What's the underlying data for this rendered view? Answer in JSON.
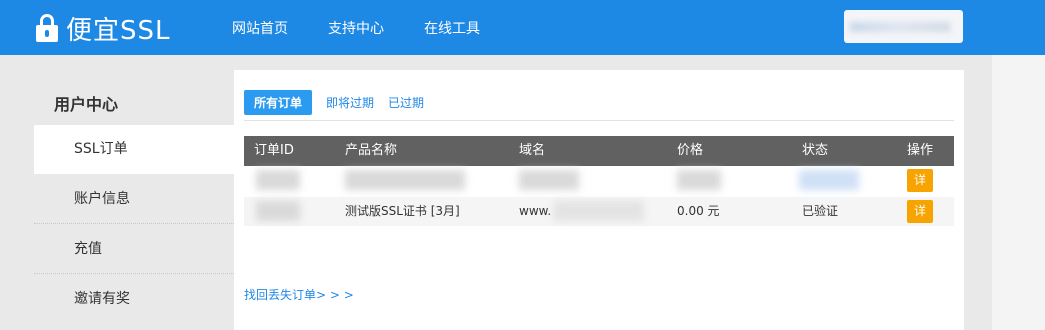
{
  "header": {
    "logo_text": "便宜SSL",
    "nav": [
      "网站首页",
      "支持中心",
      "在线工具"
    ]
  },
  "sidebar": {
    "title": "用户中心",
    "items": [
      "SSL订单",
      "账户信息",
      "充值",
      "邀请有奖"
    ]
  },
  "tabs": [
    "所有订单",
    "即将过期",
    "已过期"
  ],
  "table": {
    "columns": [
      "订单ID",
      "产品名称",
      "域名",
      "价格",
      "状态",
      "操作"
    ],
    "rows": [
      {
        "order_id": "",
        "product": "",
        "domain": "",
        "price": "",
        "status": "",
        "action": "详"
      },
      {
        "order_id": "",
        "product": "测试版SSL证书 [3月]",
        "domain": "www.",
        "price": "0.00 元",
        "status": "已验证",
        "action": "详"
      }
    ]
  },
  "lost_order_link": "找回丢失订单> > >",
  "colors": {
    "header": "#1e88e5",
    "table_head": "#616161",
    "detail_button": "#f7a400"
  }
}
